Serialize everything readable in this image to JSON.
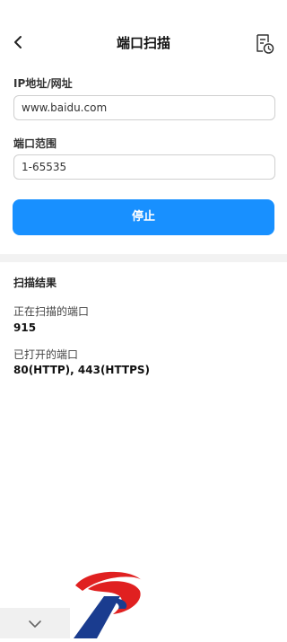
{
  "header": {
    "title": "端口扫描",
    "back_icon": "back-arrow-icon",
    "history_icon": "history-list-icon"
  },
  "form": {
    "ip_label": "IP地址/网址",
    "ip_value": "www.baidu.com",
    "port_label": "端口范围",
    "port_value": "1-65535",
    "stop_label": "停止"
  },
  "results": {
    "title": "扫描结果",
    "scanning_label": "正在扫描的端口",
    "scanning_value": "915",
    "open_label": "已打开的端口",
    "open_value": "80(HTTP), 443(HTTPS)"
  },
  "overlay": {
    "chevron_icon": "chevron-down-icon",
    "logo_icon": "brand-logo-icon"
  },
  "colors": {
    "accent": "#1890ff",
    "logo_red": "#e02020",
    "logo_blue": "#1a3c8f"
  }
}
